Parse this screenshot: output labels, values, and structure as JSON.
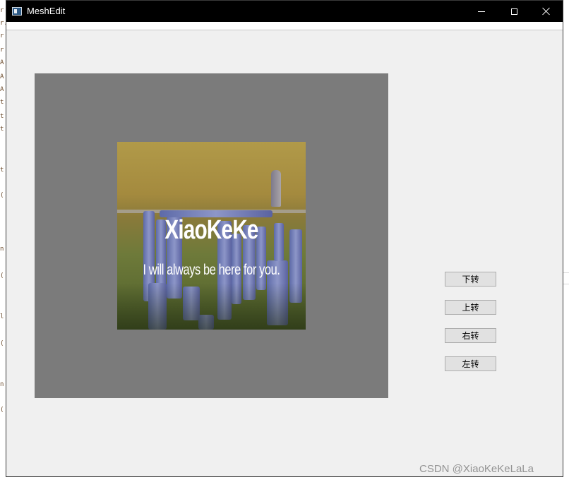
{
  "window": {
    "title": "MeshEdit",
    "icon": "app-window-icon",
    "controls": [
      "minimize-icon",
      "maximize-icon",
      "close-icon"
    ]
  },
  "texture": {
    "title": "XiaoKeKe",
    "subtitle": "I will always be here for you."
  },
  "buttons": {
    "down_label": "下转",
    "up_label": "上转",
    "right_label": "右转",
    "left_label": "左转"
  },
  "watermark": "CSDN @XiaoKeKeLaLa",
  "colors": {
    "titlebar": "#000000",
    "window_bg": "#f0f0f0",
    "viewport_bg": "#7b7b7b",
    "button_bg": "#e1e1e1"
  }
}
